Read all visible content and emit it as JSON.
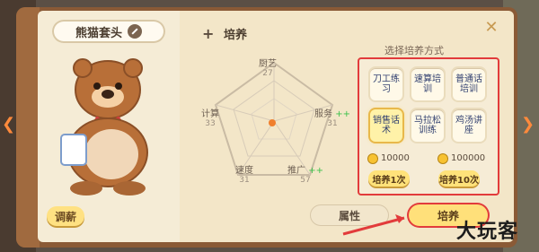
{
  "title_panel": {
    "plus": "+",
    "label": "培养"
  },
  "profile": {
    "name": "熊猫套头",
    "tune_button": "调薪"
  },
  "stats": [
    {
      "name": "厨艺",
      "value": "27"
    },
    {
      "name": "服务",
      "value": "31",
      "extra": "++"
    },
    {
      "name": "推广",
      "value": "57",
      "extra": "++"
    },
    {
      "name": "速度",
      "value": "31"
    },
    {
      "name": "计算",
      "value": "33"
    }
  ],
  "training": {
    "header": "选择培养方式",
    "options": [
      "刀工练习",
      "速算培训",
      "普通话培训",
      "销售话术",
      "马拉松训练",
      "鸡汤讲座"
    ],
    "selected_index": 3,
    "costs": [
      {
        "coins": "10000",
        "button": "培养1次"
      },
      {
        "coins": "100000",
        "button": "培养10次"
      }
    ]
  },
  "tabs": {
    "attributes": "属性",
    "training": "培养"
  },
  "watermark": "大玩客",
  "colors": {
    "highlight": "#e23b3b",
    "accent": "#ffe07a"
  }
}
